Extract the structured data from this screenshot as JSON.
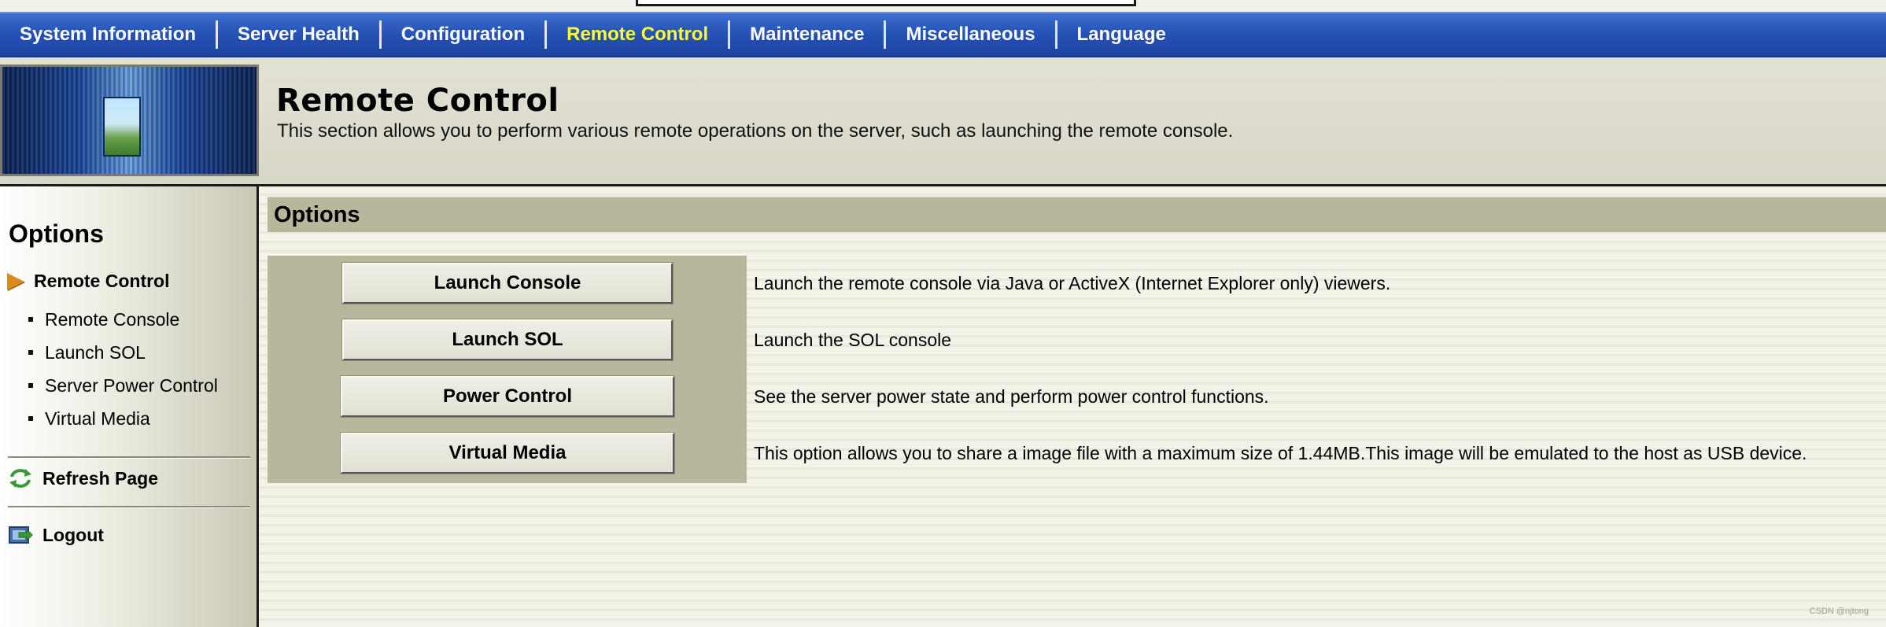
{
  "topnav": {
    "items": [
      {
        "label": "System Information"
      },
      {
        "label": "Server Health"
      },
      {
        "label": "Configuration"
      },
      {
        "label": "Remote Control"
      },
      {
        "label": "Maintenance"
      },
      {
        "label": "Miscellaneous"
      },
      {
        "label": "Language"
      }
    ],
    "active_label": "Remote Control",
    "active_color": "#ffff33",
    "bar_color": "#2653b8"
  },
  "header": {
    "title": "Remote Control",
    "description": "This section allows you to perform various remote operations on the server, such as launching the remote console."
  },
  "sidebar": {
    "heading": "Options",
    "section": {
      "label": "Remote Control",
      "icon": "orange-arrow-icon"
    },
    "items": [
      {
        "label": "Remote Console"
      },
      {
        "label": "Launch SOL"
      },
      {
        "label": "Server Power Control"
      },
      {
        "label": "Virtual Media"
      }
    ],
    "refresh": {
      "label": "Refresh Page",
      "icon": "refresh-icon"
    },
    "logout": {
      "label": "Logout",
      "icon": "logout-icon"
    }
  },
  "main": {
    "options_title": "Options",
    "actions": [
      {
        "button": "Launch Console",
        "description": "Launch the remote console via Java or ActiveX (Internet Explorer only) viewers."
      },
      {
        "button": "Launch SOL",
        "description": "Launch the SOL console"
      },
      {
        "button": "Power Control",
        "description": "See the server power state and perform power control functions."
      },
      {
        "button": "Virtual Media",
        "description": "This option allows you to share a image file with a maximum size of 1.44MB.This image will be emulated to the host as USB device."
      }
    ]
  },
  "watermark": "CSDN @njtong"
}
